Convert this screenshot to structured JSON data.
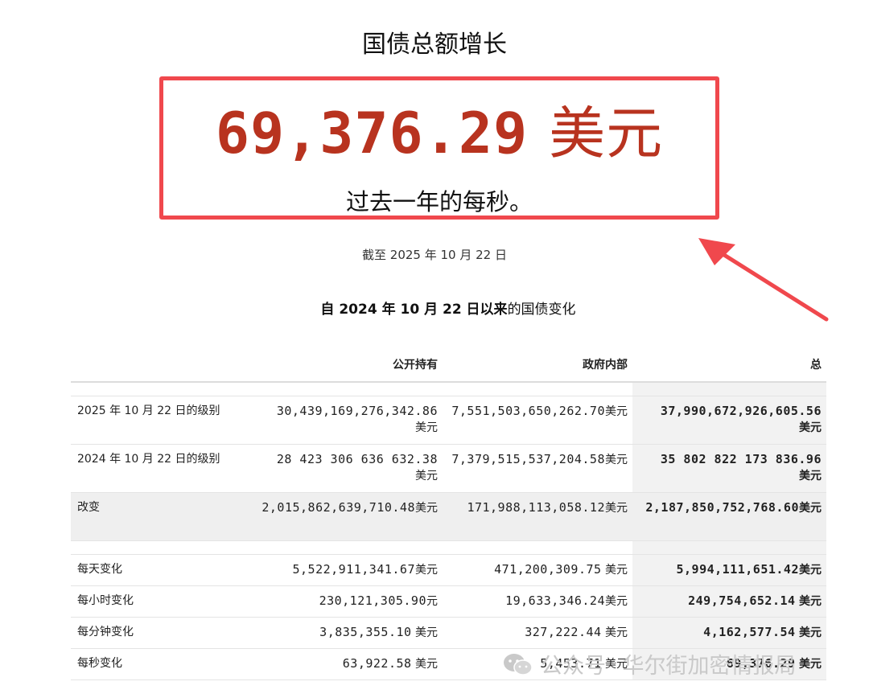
{
  "header": {
    "title": "国债总额增长",
    "per_second_value": "69,376.29",
    "per_second_unit": "美元",
    "per_second_caption": "过去一年的每秒。",
    "as_of": "截至 2025 年 10 月 22 日",
    "subtitle_bold": "自 2024 年 10 月 22 日以来",
    "subtitle_rest": "的国债变化"
  },
  "table": {
    "columns": [
      "",
      "公开持有",
      "政府内部",
      "总"
    ],
    "rows": [
      {
        "label": "2025 年 10 月 22 日的级别",
        "public": "30,439,169,276,342.86",
        "public_unit": "美元",
        "intra": "7,551,503,650,262.70",
        "intra_unit": "美元",
        "total": "37,990,672,926,605.56",
        "total_unit": "美元"
      },
      {
        "label": "2024 年 10 月 22 日的级别",
        "public": "28 423 306 636 632.38",
        "public_unit": "美元",
        "intra": "7,379,515,537,204.58",
        "intra_unit": "美元",
        "total": "35 802 822 173 836.96",
        "total_unit": "美元"
      },
      {
        "label": "改变",
        "public": "2,015,862,639,710.48",
        "public_unit": "美元",
        "intra": "171,988,113,058.12",
        "intra_unit": "美元",
        "total": "2,187,850,752,768.60",
        "total_unit": "美元"
      },
      {
        "label": "每天变化",
        "public": "5,522,911,341.67",
        "public_unit": "美元",
        "intra": "471,200,309.75",
        "intra_unit": "美元",
        "total": "5,994,111,651.42",
        "total_unit": "美元"
      },
      {
        "label": "每小时变化",
        "public": "230,121,305.90",
        "public_unit": "元",
        "intra": "19,633,346.24",
        "intra_unit": "美元",
        "total": "249,754,652.14",
        "total_unit": "美元"
      },
      {
        "label": "每分钟变化",
        "public": "3,835,355.10",
        "public_unit": "美元",
        "intra": "327,222.44",
        "intra_unit": "美元",
        "total": "4,162,577.54",
        "total_unit": "美元"
      },
      {
        "label": "每秒变化",
        "public": "63,922.58",
        "public_unit": "美元",
        "intra": "5,453.71",
        "intra_unit": "美元",
        "total": "69,376.29",
        "total_unit": "美元"
      }
    ]
  },
  "watermark": {
    "left": "公众号",
    "right": "华尔街加密情报局"
  },
  "colors": {
    "accent_red": "#b8331f",
    "box_border": "#f0484d",
    "arrow": "#f0484d"
  },
  "icons": [
    "wechat-icon",
    "arrow-icon"
  ]
}
